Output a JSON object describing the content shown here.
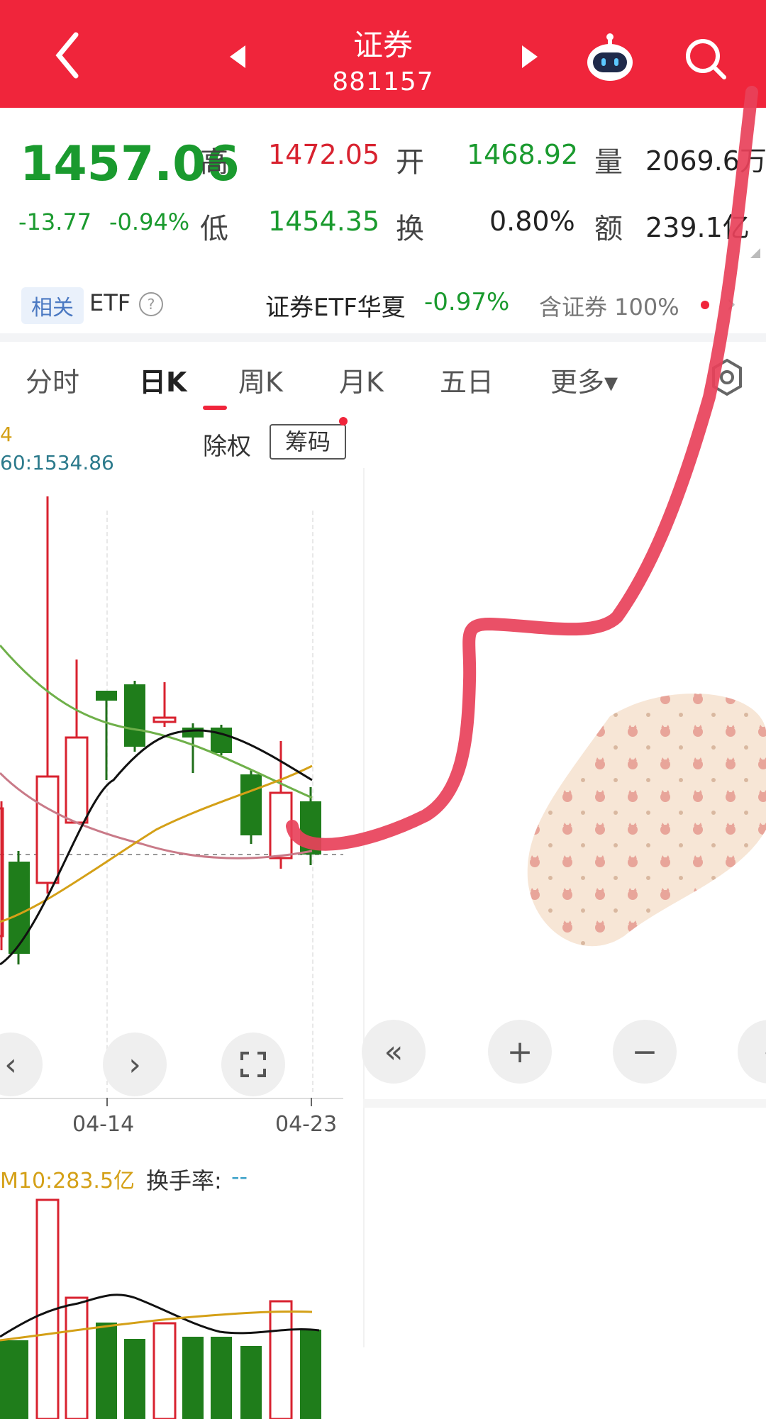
{
  "header": {
    "title": "证券",
    "code": "881157",
    "back_icon": "chevron-left-icon",
    "prev_icon": "triangle-left-icon",
    "next_icon": "triangle-right-icon",
    "robot_icon": "robot-icon",
    "search_icon": "search-icon"
  },
  "quote": {
    "price": "1457.06",
    "change": "-13.77",
    "change_pct": "-0.94%",
    "high_label": "高",
    "high": "1472.05",
    "low_label": "低",
    "low": "1454.35",
    "open_label": "开",
    "open": "1468.92",
    "turnover_label": "换",
    "turnover": "0.80%",
    "volume_label": "量",
    "volume": "2069.6万",
    "amount_label": "额",
    "amount": "239.1亿"
  },
  "etf": {
    "badge": "相关",
    "label": "ETF",
    "help_icon": "question-circle-icon",
    "name": "证券ETF华夏",
    "pct": "-0.97%",
    "holding": "含证券 100%",
    "arrow_icon": "chevron-right-icon"
  },
  "tabs": [
    "分时",
    "日K",
    "周K",
    "月K",
    "五日",
    "更多▾"
  ],
  "settings_icon": "gear-icon",
  "chart": {
    "ma_tail": "4",
    "ma60": "60:1534.86",
    "chuquan": "除权",
    "chouma": "筹码",
    "x_labels": [
      "04-14",
      "04-23"
    ],
    "vol_label": "M10:283.5亿",
    "turnover_rate_label": "换手率:",
    "turnover_rate_value": "--"
  },
  "controls": {
    "left_icon": "chevron-left-icon",
    "right_icon": "chevron-right-icon",
    "fullscreen_icon": "fullscreen-icon",
    "rewind_icon": "double-chevron-left-icon",
    "zoom_in_icon": "plus-icon",
    "zoom_out_icon": "minus-icon"
  },
  "colors": {
    "header": "#f0253b",
    "up": "#d8222f",
    "down": "#1a9a2e",
    "annotation": "#e8415a"
  }
}
